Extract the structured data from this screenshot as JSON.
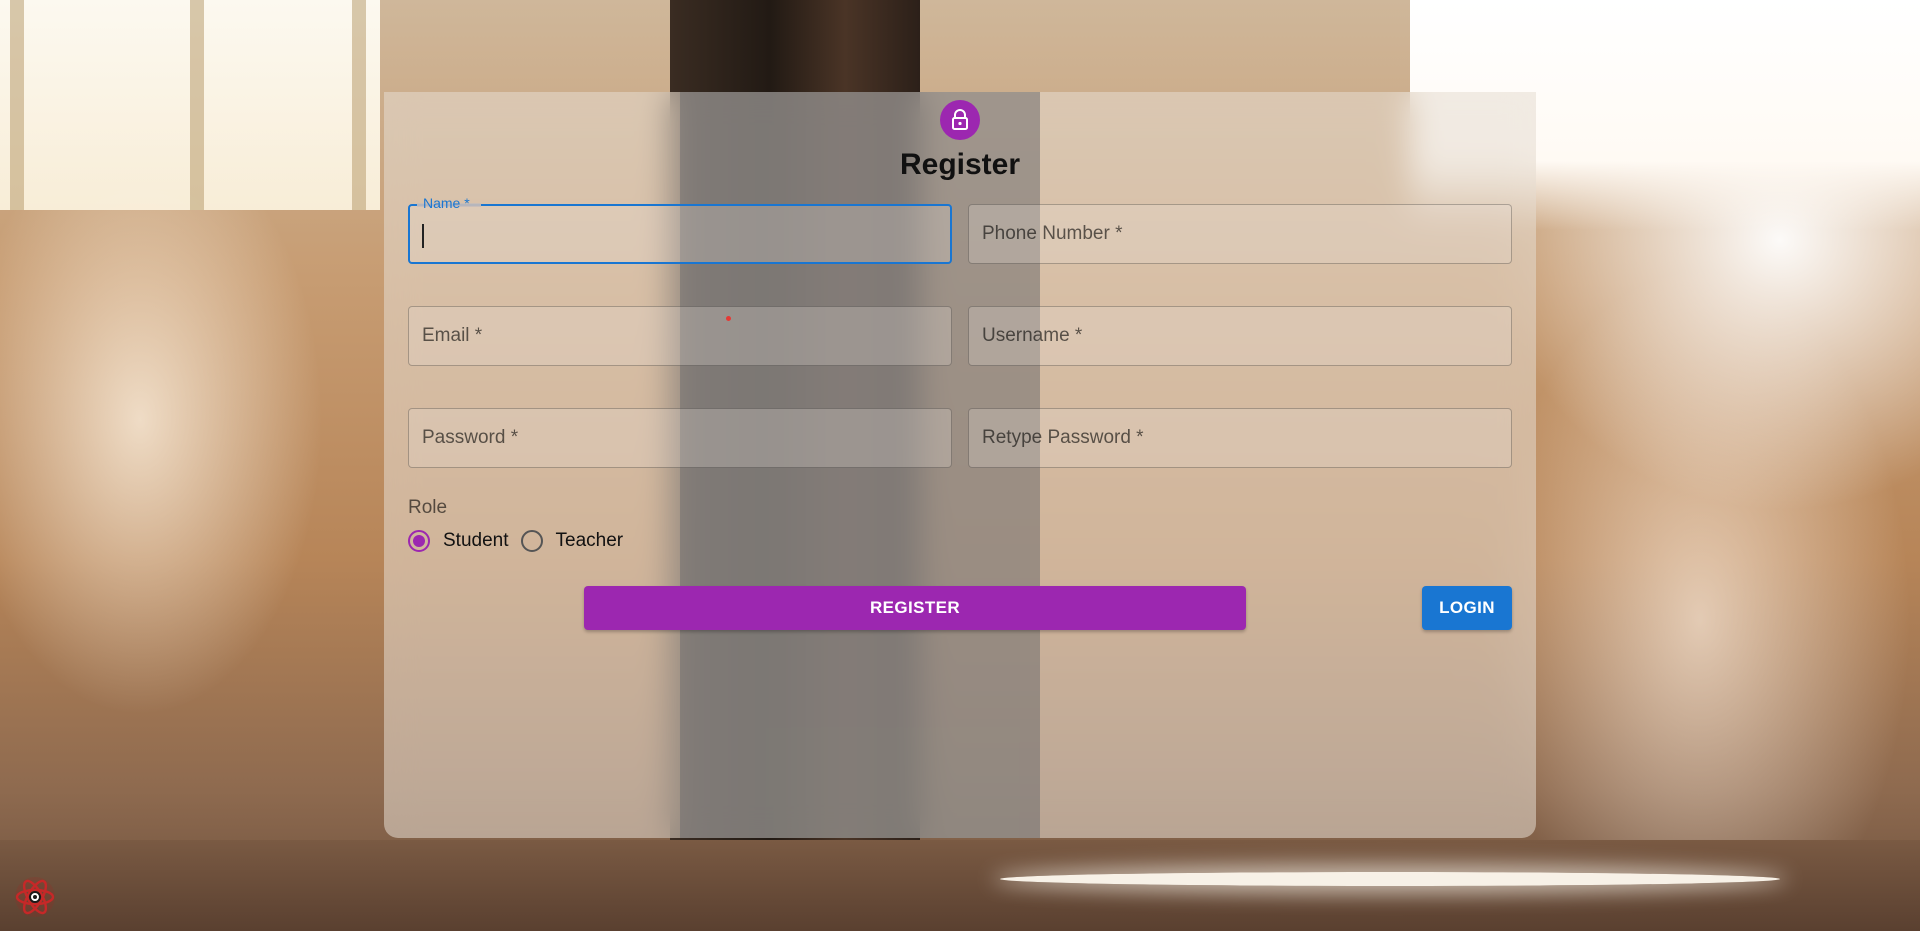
{
  "page": {
    "title": "Register"
  },
  "form": {
    "fields": {
      "name": {
        "label": "Name *",
        "value": ""
      },
      "phone": {
        "label": "Phone Number *",
        "value": ""
      },
      "email": {
        "label": "Email *",
        "value": ""
      },
      "username": {
        "label": "Username *",
        "value": ""
      },
      "password": {
        "label": "Password *",
        "value": ""
      },
      "retype_password": {
        "label": "Retype Password *",
        "value": ""
      }
    },
    "role": {
      "label": "Role",
      "options": [
        {
          "label": "Student",
          "selected": true
        },
        {
          "label": "Teacher",
          "selected": false
        }
      ]
    },
    "register_label": "REGISTER",
    "login_label": "LOGIN"
  },
  "icons": {
    "avatar": "lock-icon",
    "devtools": "react-icon"
  },
  "colors": {
    "primary": "#9c27b0",
    "secondary": "#1976d2"
  }
}
